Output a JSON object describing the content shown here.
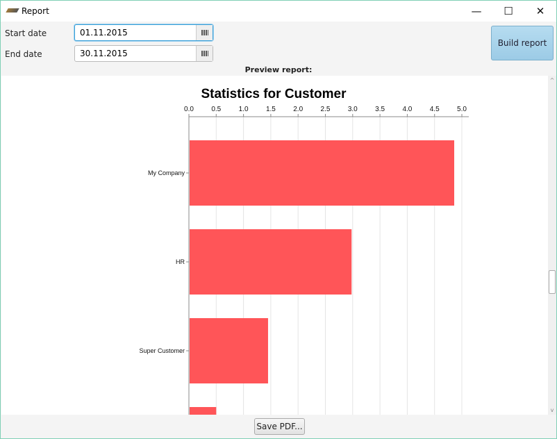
{
  "window": {
    "title": "Report",
    "minimize": "—",
    "maximize": "☐",
    "close": "✕"
  },
  "form": {
    "start_label": "Start date",
    "start_value": "01.11.2015",
    "end_label": "End date",
    "end_value": "30.11.2015",
    "build_label": "Build report",
    "preview_label": "Preview report:"
  },
  "footer": {
    "save_label": "Save PDF..."
  },
  "colors": {
    "bar": "#ff5558",
    "accent": "#9ccbe6"
  },
  "chart_data": {
    "type": "bar",
    "orientation": "horizontal",
    "title": "Statistics for Customer",
    "categories": [
      "My Company",
      "HR",
      "Super Customer",
      ""
    ],
    "values": [
      4.86,
      2.98,
      1.45,
      0.5
    ],
    "xlim": [
      0,
      5.0
    ],
    "xticks": [
      "0.0",
      "0.5",
      "1.0",
      "1.5",
      "2.0",
      "2.5",
      "3.0",
      "3.5",
      "4.0",
      "4.5",
      "5.0"
    ],
    "axis_position": "top",
    "grid": true
  }
}
